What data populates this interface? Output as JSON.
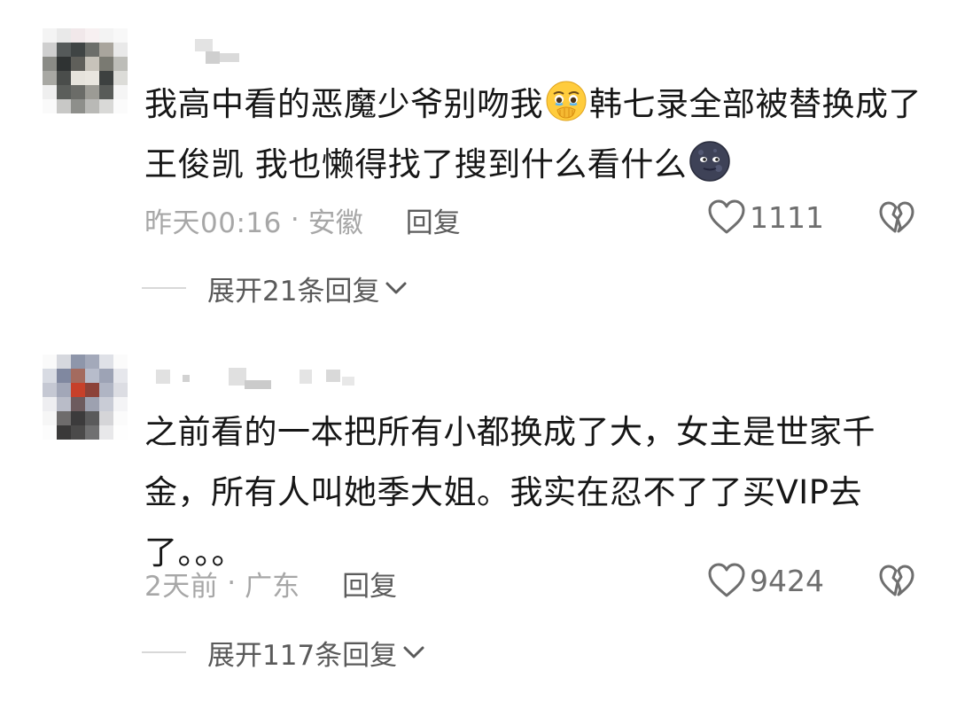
{
  "comments": [
    {
      "text_part1": "我高中看的恶魔少爷别吻我",
      "text_part2": "韩七录全部被替换成了王俊凯 我也懒得找了搜到什么看什么",
      "emoji1": "face-holding-back-tears-emoji",
      "emoji2": "new-moon-face-emoji",
      "time": "昨天00:16",
      "dot": "·",
      "location": "安徽",
      "reply_label": "回复",
      "like_count": "1111",
      "expand_label": "展开21条回复"
    },
    {
      "text": "之前看的一本把所有小都换成了大，女主是世家千金，所有人叫她季大姐。我实在忍不了了买VIP去了。。。",
      "time": "2天前",
      "dot": "·",
      "location": "广东",
      "reply_label": "回复",
      "like_count": "9424",
      "expand_label": "展开117条回复"
    }
  ],
  "icons": {
    "like": "heart-outline-icon",
    "dislike": "broken-heart-icon",
    "expand": "chevron-down-icon"
  },
  "colors": {
    "text": "#161616",
    "meta": "#a7a7a7",
    "action": "#5c5c5c",
    "divider": "#d8d8d8"
  }
}
